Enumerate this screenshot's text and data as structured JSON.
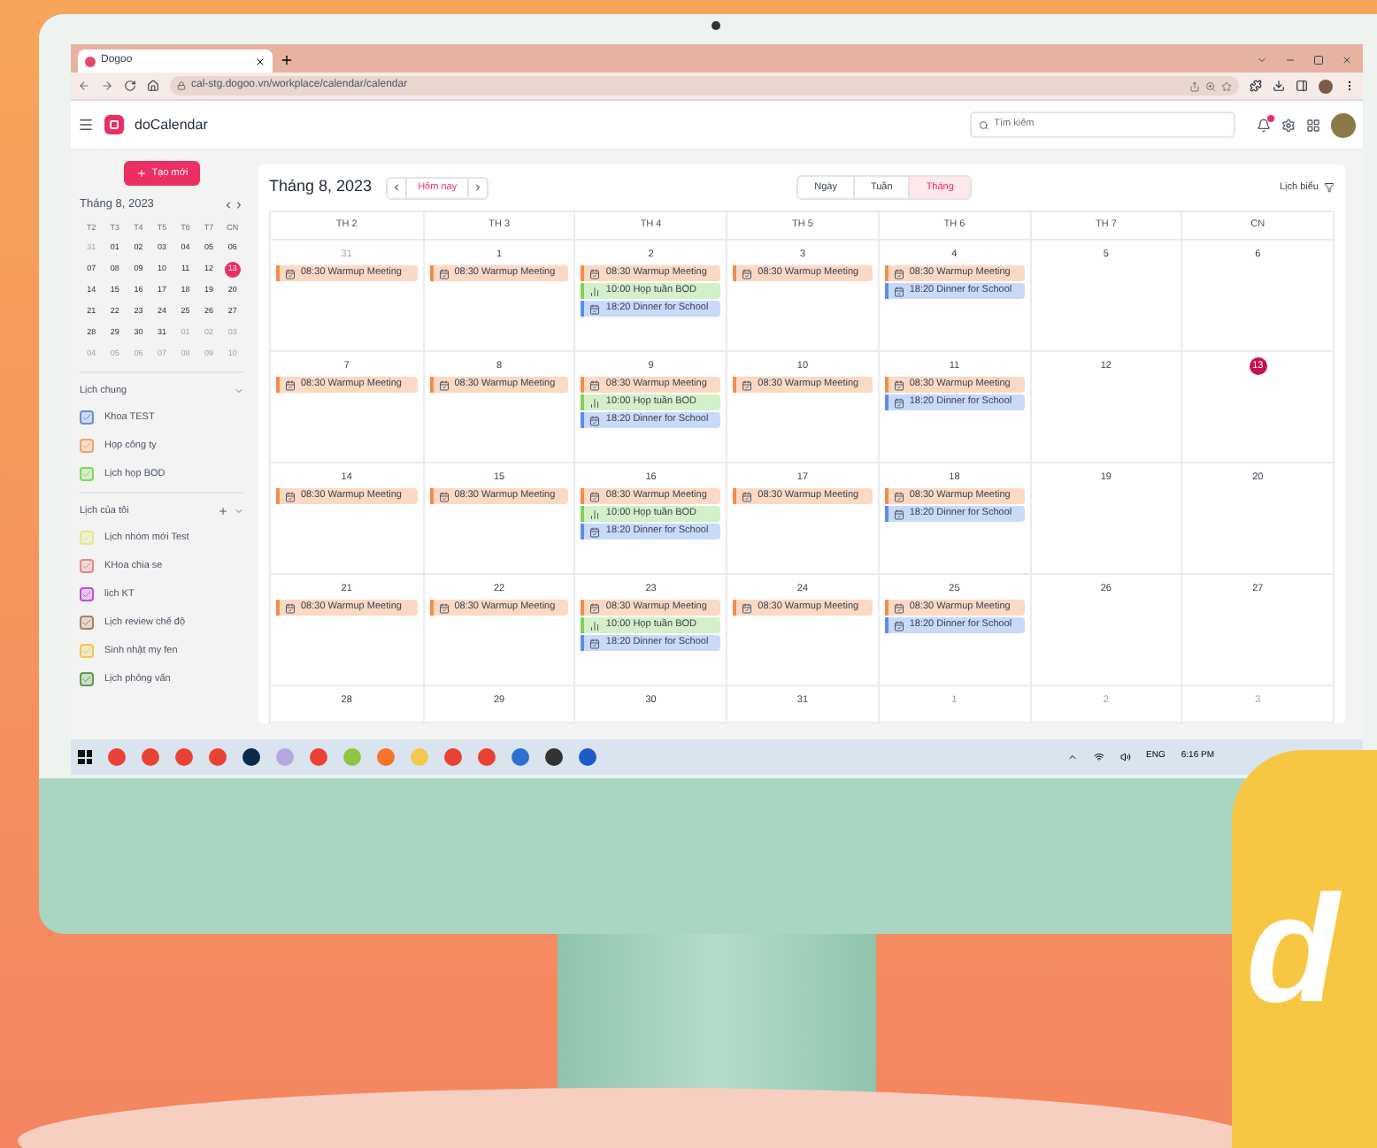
{
  "browser": {
    "tab_title": "Dogoo",
    "url": "cal-stg.dogoo.vn/workplace/calendar/calendar"
  },
  "app": {
    "name": "doCalendar",
    "search_placeholder": "Tìm kiếm"
  },
  "sidebar": {
    "create_button": "Tạo mới",
    "mini_calendar": {
      "title": "Tháng 8, 2023",
      "weekdays": [
        "T2",
        "T3",
        "T4",
        "T5",
        "T6",
        "T7",
        "CN"
      ],
      "weeks": [
        [
          {
            "d": "31",
            "in_month": false,
            "selected": false
          },
          {
            "d": "01",
            "in_month": true,
            "selected": false
          },
          {
            "d": "02",
            "in_month": true,
            "selected": false
          },
          {
            "d": "03",
            "in_month": true,
            "selected": false
          },
          {
            "d": "04",
            "in_month": true,
            "selected": false
          },
          {
            "d": "05",
            "in_month": true,
            "selected": false
          },
          {
            "d": "06",
            "in_month": true,
            "selected": false
          }
        ],
        [
          {
            "d": "07",
            "in_month": true,
            "selected": false
          },
          {
            "d": "08",
            "in_month": true,
            "selected": false
          },
          {
            "d": "09",
            "in_month": true,
            "selected": false
          },
          {
            "d": "10",
            "in_month": true,
            "selected": false
          },
          {
            "d": "11",
            "in_month": true,
            "selected": false
          },
          {
            "d": "12",
            "in_month": true,
            "selected": false
          },
          {
            "d": "13",
            "in_month": true,
            "selected": true
          }
        ],
        [
          {
            "d": "14",
            "in_month": true,
            "selected": false
          },
          {
            "d": "15",
            "in_month": true,
            "selected": false
          },
          {
            "d": "16",
            "in_month": true,
            "selected": false
          },
          {
            "d": "17",
            "in_month": true,
            "selected": false
          },
          {
            "d": "18",
            "in_month": true,
            "selected": false
          },
          {
            "d": "19",
            "in_month": true,
            "selected": false
          },
          {
            "d": "20",
            "in_month": true,
            "selected": false
          }
        ],
        [
          {
            "d": "21",
            "in_month": true,
            "selected": false
          },
          {
            "d": "22",
            "in_month": true,
            "selected": false
          },
          {
            "d": "23",
            "in_month": true,
            "selected": false
          },
          {
            "d": "24",
            "in_month": true,
            "selected": false
          },
          {
            "d": "25",
            "in_month": true,
            "selected": false
          },
          {
            "d": "26",
            "in_month": true,
            "selected": false
          },
          {
            "d": "27",
            "in_month": true,
            "selected": false
          }
        ],
        [
          {
            "d": "28",
            "in_month": true,
            "selected": false
          },
          {
            "d": "29",
            "in_month": true,
            "selected": false
          },
          {
            "d": "30",
            "in_month": true,
            "selected": false
          },
          {
            "d": "31",
            "in_month": true,
            "selected": false
          },
          {
            "d": "01",
            "in_month": false,
            "selected": false
          },
          {
            "d": "02",
            "in_month": false,
            "selected": false
          },
          {
            "d": "03",
            "in_month": false,
            "selected": false
          }
        ],
        [
          {
            "d": "04",
            "in_month": false,
            "selected": false
          },
          {
            "d": "05",
            "in_month": false,
            "selected": false
          },
          {
            "d": "06",
            "in_month": false,
            "selected": false
          },
          {
            "d": "07",
            "in_month": false,
            "selected": false
          },
          {
            "d": "08",
            "in_month": false,
            "selected": false
          },
          {
            "d": "09",
            "in_month": false,
            "selected": false
          },
          {
            "d": "10",
            "in_month": false,
            "selected": false
          }
        ]
      ]
    },
    "groups": [
      {
        "title": "Lịch chung",
        "can_add": false,
        "items": [
          {
            "label": "Khoa TEST",
            "color": "#6c8fd6",
            "checked": true
          },
          {
            "label": "Họp công ty",
            "color": "#f4a261",
            "checked": true
          },
          {
            "label": "Lịch họp BOD",
            "color": "#7ed957",
            "checked": true
          }
        ]
      },
      {
        "title": "Lịch của tôi",
        "can_add": true,
        "items": [
          {
            "label": "Lịch nhóm mới Test",
            "color": "#dfe98a",
            "checked": true
          },
          {
            "label": "KHoa chia se",
            "color": "#e08a8a",
            "checked": true
          },
          {
            "label": "lich KT",
            "color": "#c04ee0",
            "checked": true
          },
          {
            "label": "Lịch review chế độ",
            "color": "#a9825e",
            "checked": true
          },
          {
            "label": "Sinh nhật my fen",
            "color": "#f5c451",
            "checked": true
          },
          {
            "label": "Lịch phỏng vấn",
            "color": "#5f9a4c",
            "checked": true
          }
        ]
      }
    ]
  },
  "main": {
    "title": "Tháng 8, 2023",
    "today_button": "Hôm nay",
    "views": [
      {
        "label": "Ngày",
        "selected": false
      },
      {
        "label": "Tuần",
        "selected": false
      },
      {
        "label": "Tháng",
        "selected": true
      }
    ],
    "filter": "Lịch biểu",
    "weekdays": [
      "TH 2",
      "TH 3",
      "TH 4",
      "TH 5",
      "TH 6",
      "TH 7",
      "CN"
    ],
    "weeks": [
      [
        {
          "day": "31",
          "in_month": false,
          "today": false,
          "events": [
            {
              "kind": "task",
              "text": "08:30 Warmup Meeting",
              "color": "#f58c4c"
            }
          ]
        },
        {
          "day": "1",
          "in_month": true,
          "today": false,
          "events": [
            {
              "kind": "task",
              "text": "08:30 Warmup Meeting",
              "color": "#f58c4c"
            }
          ]
        },
        {
          "day": "2",
          "in_month": true,
          "today": false,
          "events": [
            {
              "kind": "task",
              "text": "08:30 Warmup Meeting",
              "color": "#f58c4c"
            },
            {
              "kind": "meeting",
              "text": "10:00 Họp tuần BOD",
              "color": "#7dd35a"
            },
            {
              "kind": "task",
              "text": "18:20 Dinner for School",
              "color": "#5b8def"
            }
          ]
        },
        {
          "day": "3",
          "in_month": true,
          "today": false,
          "events": [
            {
              "kind": "task",
              "text": "08:30 Warmup Meeting",
              "color": "#f58c4c"
            }
          ]
        },
        {
          "day": "4",
          "in_month": true,
          "today": false,
          "events": [
            {
              "kind": "task",
              "text": "08:30 Warmup Meeting",
              "color": "#f58c4c"
            },
            {
              "kind": "task",
              "text": "18:20 Dinner for School",
              "color": "#5b8def"
            }
          ]
        },
        {
          "day": "5",
          "in_month": true,
          "today": false
        },
        {
          "day": "6",
          "in_month": true,
          "today": false
        }
      ],
      [
        {
          "day": "7",
          "in_month": true,
          "today": false,
          "events": [
            {
              "kind": "task",
              "text": "08:30 Warmup Meeting",
              "color": "#f58c4c"
            }
          ]
        },
        {
          "day": "8",
          "in_month": true,
          "today": false,
          "events": [
            {
              "kind": "task",
              "text": "08:30 Warmup Meeting",
              "color": "#f58c4c"
            }
          ]
        },
        {
          "day": "9",
          "in_month": true,
          "today": false,
          "events": [
            {
              "kind": "task",
              "text": "08:30 Warmup Meeting",
              "color": "#f58c4c"
            },
            {
              "kind": "meeting",
              "text": "10:00 Họp tuần BOD",
              "color": "#7dd35a"
            },
            {
              "kind": "task",
              "text": "18:20 Dinner for School",
              "color": "#5b8def"
            }
          ]
        },
        {
          "day": "10",
          "in_month": true,
          "today": false,
          "events": [
            {
              "kind": "task",
              "text": "08:30 Warmup Meeting",
              "color": "#f58c4c"
            }
          ]
        },
        {
          "day": "11",
          "in_month": true,
          "today": false,
          "events": [
            {
              "kind": "task",
              "text": "08:30 Warmup Meeting",
              "color": "#f58c4c"
            },
            {
              "kind": "task",
              "text": "18:20 Dinner for School",
              "color": "#5b8def"
            }
          ]
        },
        {
          "day": "12",
          "in_month": true,
          "today": false
        },
        {
          "day": "13",
          "in_month": true,
          "today": true
        }
      ],
      [
        {
          "day": "14",
          "in_month": true,
          "today": false,
          "events": [
            {
              "kind": "task",
              "text": "08:30 Warmup Meeting",
              "color": "#f58c4c"
            }
          ]
        },
        {
          "day": "15",
          "in_month": true,
          "today": false,
          "events": [
            {
              "kind": "task",
              "text": "08:30 Warmup Meeting",
              "color": "#f58c4c"
            }
          ]
        },
        {
          "day": "16",
          "in_month": true,
          "today": false,
          "events": [
            {
              "kind": "task",
              "text": "08:30 Warmup Meeting",
              "color": "#f58c4c"
            },
            {
              "kind": "meeting",
              "text": "10:00 Họp tuần BOD",
              "color": "#7dd35a"
            },
            {
              "kind": "task",
              "text": "18:20 Dinner for School",
              "color": "#5b8def"
            }
          ]
        },
        {
          "day": "17",
          "in_month": true,
          "today": false,
          "events": [
            {
              "kind": "task",
              "text": "08:30 Warmup Meeting",
              "color": "#f58c4c"
            }
          ]
        },
        {
          "day": "18",
          "in_month": true,
          "today": false,
          "events": [
            {
              "kind": "task",
              "text": "08:30 Warmup Meeting",
              "color": "#f58c4c"
            },
            {
              "kind": "task",
              "text": "18:20 Dinner for School",
              "color": "#5b8def"
            }
          ]
        },
        {
          "day": "19",
          "in_month": true,
          "today": false
        },
        {
          "day": "20",
          "in_month": true,
          "today": false
        }
      ],
      [
        {
          "day": "21",
          "in_month": true,
          "today": false,
          "events": [
            {
              "kind": "task",
              "text": "08:30 Warmup Meeting",
              "color": "#f58c4c"
            }
          ]
        },
        {
          "day": "22",
          "in_month": true,
          "today": false,
          "events": [
            {
              "kind": "task",
              "text": "08:30 Warmup Meeting",
              "color": "#f58c4c"
            }
          ]
        },
        {
          "day": "23",
          "in_month": true,
          "today": false,
          "events": [
            {
              "kind": "task",
              "text": "08:30 Warmup Meeting",
              "color": "#f58c4c"
            },
            {
              "kind": "meeting",
              "text": "10:00 Họp tuần BOD",
              "color": "#7dd35a"
            },
            {
              "kind": "task",
              "text": "18:20 Dinner for School",
              "color": "#5b8def"
            }
          ]
        },
        {
          "day": "24",
          "in_month": true,
          "today": false,
          "events": [
            {
              "kind": "task",
              "text": "08:30 Warmup Meeting",
              "color": "#f58c4c"
            }
          ]
        },
        {
          "day": "25",
          "in_month": true,
          "today": false,
          "events": [
            {
              "kind": "task",
              "text": "08:30 Warmup Meeting",
              "color": "#f58c4c"
            },
            {
              "kind": "task",
              "text": "18:20 Dinner for School",
              "color": "#5b8def"
            }
          ]
        },
        {
          "day": "26",
          "in_month": true,
          "today": false
        },
        {
          "day": "27",
          "in_month": true,
          "today": false
        }
      ],
      [
        {
          "day": "28",
          "in_month": true,
          "today": false
        },
        {
          "day": "29",
          "in_month": true,
          "today": false
        },
        {
          "day": "30",
          "in_month": true,
          "today": false
        },
        {
          "day": "31",
          "in_month": true,
          "today": false
        },
        {
          "day": "1",
          "in_month": false,
          "today": false
        },
        {
          "day": "2",
          "in_month": false,
          "today": false
        },
        {
          "day": "3",
          "in_month": false,
          "today": false
        }
      ]
    ]
  },
  "taskbar": {
    "language": "ENG",
    "time": "6:16 PM"
  },
  "brand_badge": {
    "text": "d"
  }
}
